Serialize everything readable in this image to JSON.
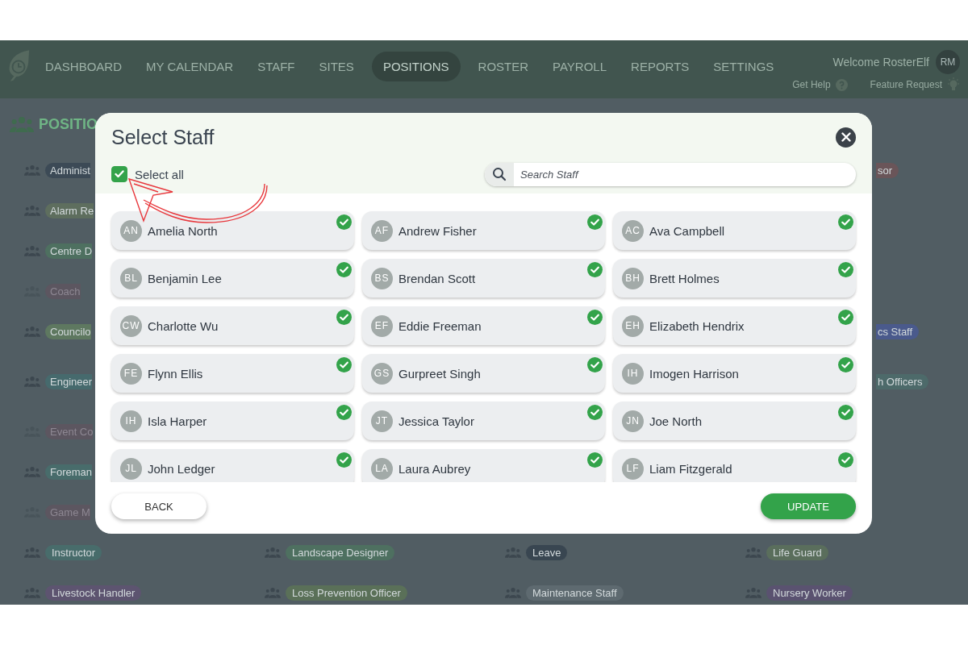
{
  "header": {
    "nav": [
      {
        "label": "DASHBOARD",
        "selected": false
      },
      {
        "label": "MY CALENDAR",
        "selected": false
      },
      {
        "label": "STAFF",
        "selected": false
      },
      {
        "label": "SITES",
        "selected": false
      },
      {
        "label": "POSITIONS",
        "selected": true
      },
      {
        "label": "ROSTER",
        "selected": false
      },
      {
        "label": "PAYROLL",
        "selected": false
      },
      {
        "label": "REPORTS",
        "selected": false
      },
      {
        "label": "SETTINGS",
        "selected": false
      }
    ],
    "welcome": "Welcome RosterElf",
    "avatar": "RM",
    "help": "Get Help",
    "feature": "Feature Request"
  },
  "page": {
    "title": "POSITIO",
    "rows": [
      {
        "first": {
          "label": "Administ",
          "color": "#3c4a56",
          "disabled": false
        },
        "last": {
          "label": "sor",
          "color": "#6a5559",
          "disabled": false
        }
      },
      {
        "first": {
          "label": "Alarm Re",
          "color": "#5e6e5e",
          "disabled": false
        }
      },
      {
        "first": {
          "label": "Centre D",
          "color": "#4e7060",
          "disabled": false
        }
      },
      {
        "first": {
          "label": "Coach",
          "color": "#5c5660",
          "disabled": true
        }
      },
      {
        "first": {
          "label": "Councilo",
          "color": "#5e7860",
          "disabled": false
        },
        "last": {
          "label": "cs Staff",
          "color": "#4a5a8c",
          "disabled": false
        }
      },
      {
        "first": {
          "label": "Engineer",
          "color": "#466a6d",
          "disabled": false
        },
        "last": {
          "label": "h Officers",
          "color": "#4d6a6a",
          "disabled": false
        }
      },
      {
        "first": {
          "label": "Event Co",
          "color": "#5c5660",
          "disabled": true
        }
      },
      {
        "first": {
          "label": "Foreman",
          "color": "#486c6b",
          "disabled": false
        }
      },
      {
        "first": {
          "label": "Game M",
          "color": "#5c5660",
          "disabled": true
        }
      },
      {
        "cells": [
          {
            "label": "Instructor",
            "color": "#486c6b",
            "disabled": false
          },
          {
            "label": "Landscape Designer",
            "color": "#4e7060",
            "disabled": false
          },
          {
            "label": "Leave",
            "color": "#394651",
            "disabled": false
          },
          {
            "label": "Life Guard",
            "color": "#5a6e5c",
            "disabled": false
          }
        ]
      },
      {
        "cells": [
          {
            "label": "Livestock Handler",
            "color": "#5d5470",
            "disabled": false
          },
          {
            "label": "Loss Prevention Officer",
            "color": "#5a7058",
            "disabled": false
          },
          {
            "label": "Maintenance Staff",
            "color": "#5e6a70",
            "disabled": false
          },
          {
            "label": "Nursery Worker",
            "color": "#5a5270",
            "disabled": false
          }
        ]
      }
    ]
  },
  "modal": {
    "title": "Select Staff",
    "select_all": {
      "label": "Select all",
      "checked": true
    },
    "search": {
      "placeholder": "Search Staff"
    },
    "staff": [
      {
        "initials": "AN",
        "name": "Amelia North",
        "selected": true
      },
      {
        "initials": "AF",
        "name": "Andrew Fisher",
        "selected": true
      },
      {
        "initials": "AC",
        "name": "Ava Campbell",
        "selected": true
      },
      {
        "initials": "BL",
        "name": "Benjamin Lee",
        "selected": true
      },
      {
        "initials": "BS",
        "name": "Brendan Scott",
        "selected": true
      },
      {
        "initials": "BH",
        "name": "Brett Holmes",
        "selected": true
      },
      {
        "initials": "CW",
        "name": "Charlotte Wu",
        "selected": true
      },
      {
        "initials": "EF",
        "name": "Eddie Freeman",
        "selected": true
      },
      {
        "initials": "EH",
        "name": "Elizabeth Hendrix",
        "selected": true
      },
      {
        "initials": "FE",
        "name": "Flynn Ellis",
        "selected": true
      },
      {
        "initials": "GS",
        "name": "Gurpreet Singh",
        "selected": true
      },
      {
        "initials": "IH",
        "name": "Imogen Harrison",
        "selected": true
      },
      {
        "initials": "IH",
        "name": "Isla Harper",
        "selected": true
      },
      {
        "initials": "JT",
        "name": "Jessica Taylor",
        "selected": true
      },
      {
        "initials": "JN",
        "name": "Joe North",
        "selected": true
      },
      {
        "initials": "JL",
        "name": "John Ledger",
        "selected": true
      },
      {
        "initials": "LA",
        "name": "Laura Aubrey",
        "selected": true
      },
      {
        "initials": "LF",
        "name": "Liam Fitzgerald",
        "selected": true
      }
    ],
    "back": "BACK",
    "update": "UPDATE"
  }
}
